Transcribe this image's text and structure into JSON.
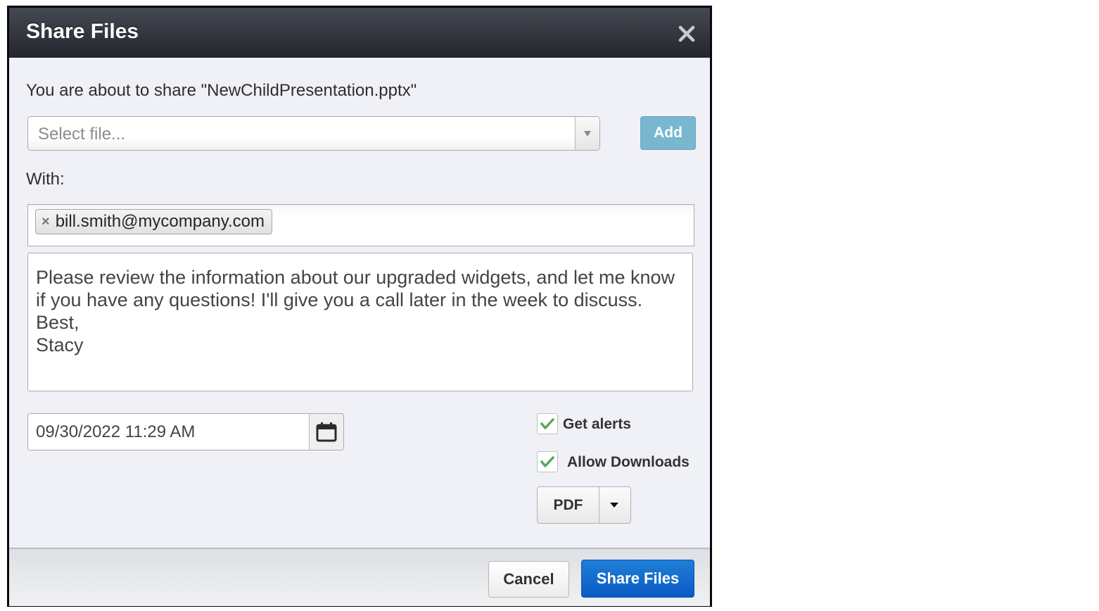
{
  "dialog": {
    "title": "Share Files",
    "close_icon": "close-icon",
    "intro_text": "You are about to share \"NewChildPresentation.pptx\"",
    "file_select": {
      "placeholder": "Select file...",
      "icon": "chevron-down-icon"
    },
    "add_label": "Add",
    "with_label": "With:",
    "recipients": [
      {
        "email": "bill.smith@mycompany.com",
        "remove_icon": "remove-icon"
      }
    ],
    "message": "Please review the information about our upgraded widgets, and let me know if you have any questions! I'll give you a call later in the week to discuss.\nBest,\nStacy",
    "expiration": {
      "value": "09/30/2022 11:29 AM",
      "icon": "calendar-icon"
    },
    "options": [
      {
        "label": "Get alerts",
        "checked": true
      },
      {
        "label": "Allow Downloads",
        "checked": true
      }
    ],
    "format": {
      "selected": "PDF",
      "icon": "caret-down-icon"
    },
    "footer": {
      "cancel_label": "Cancel",
      "share_label": "Share Files"
    }
  },
  "colors": {
    "primary_button": "#0a5ac4",
    "add_button": "#78b7cf",
    "checkmark": "#5aa75a",
    "titlebar": "#2f3239"
  }
}
